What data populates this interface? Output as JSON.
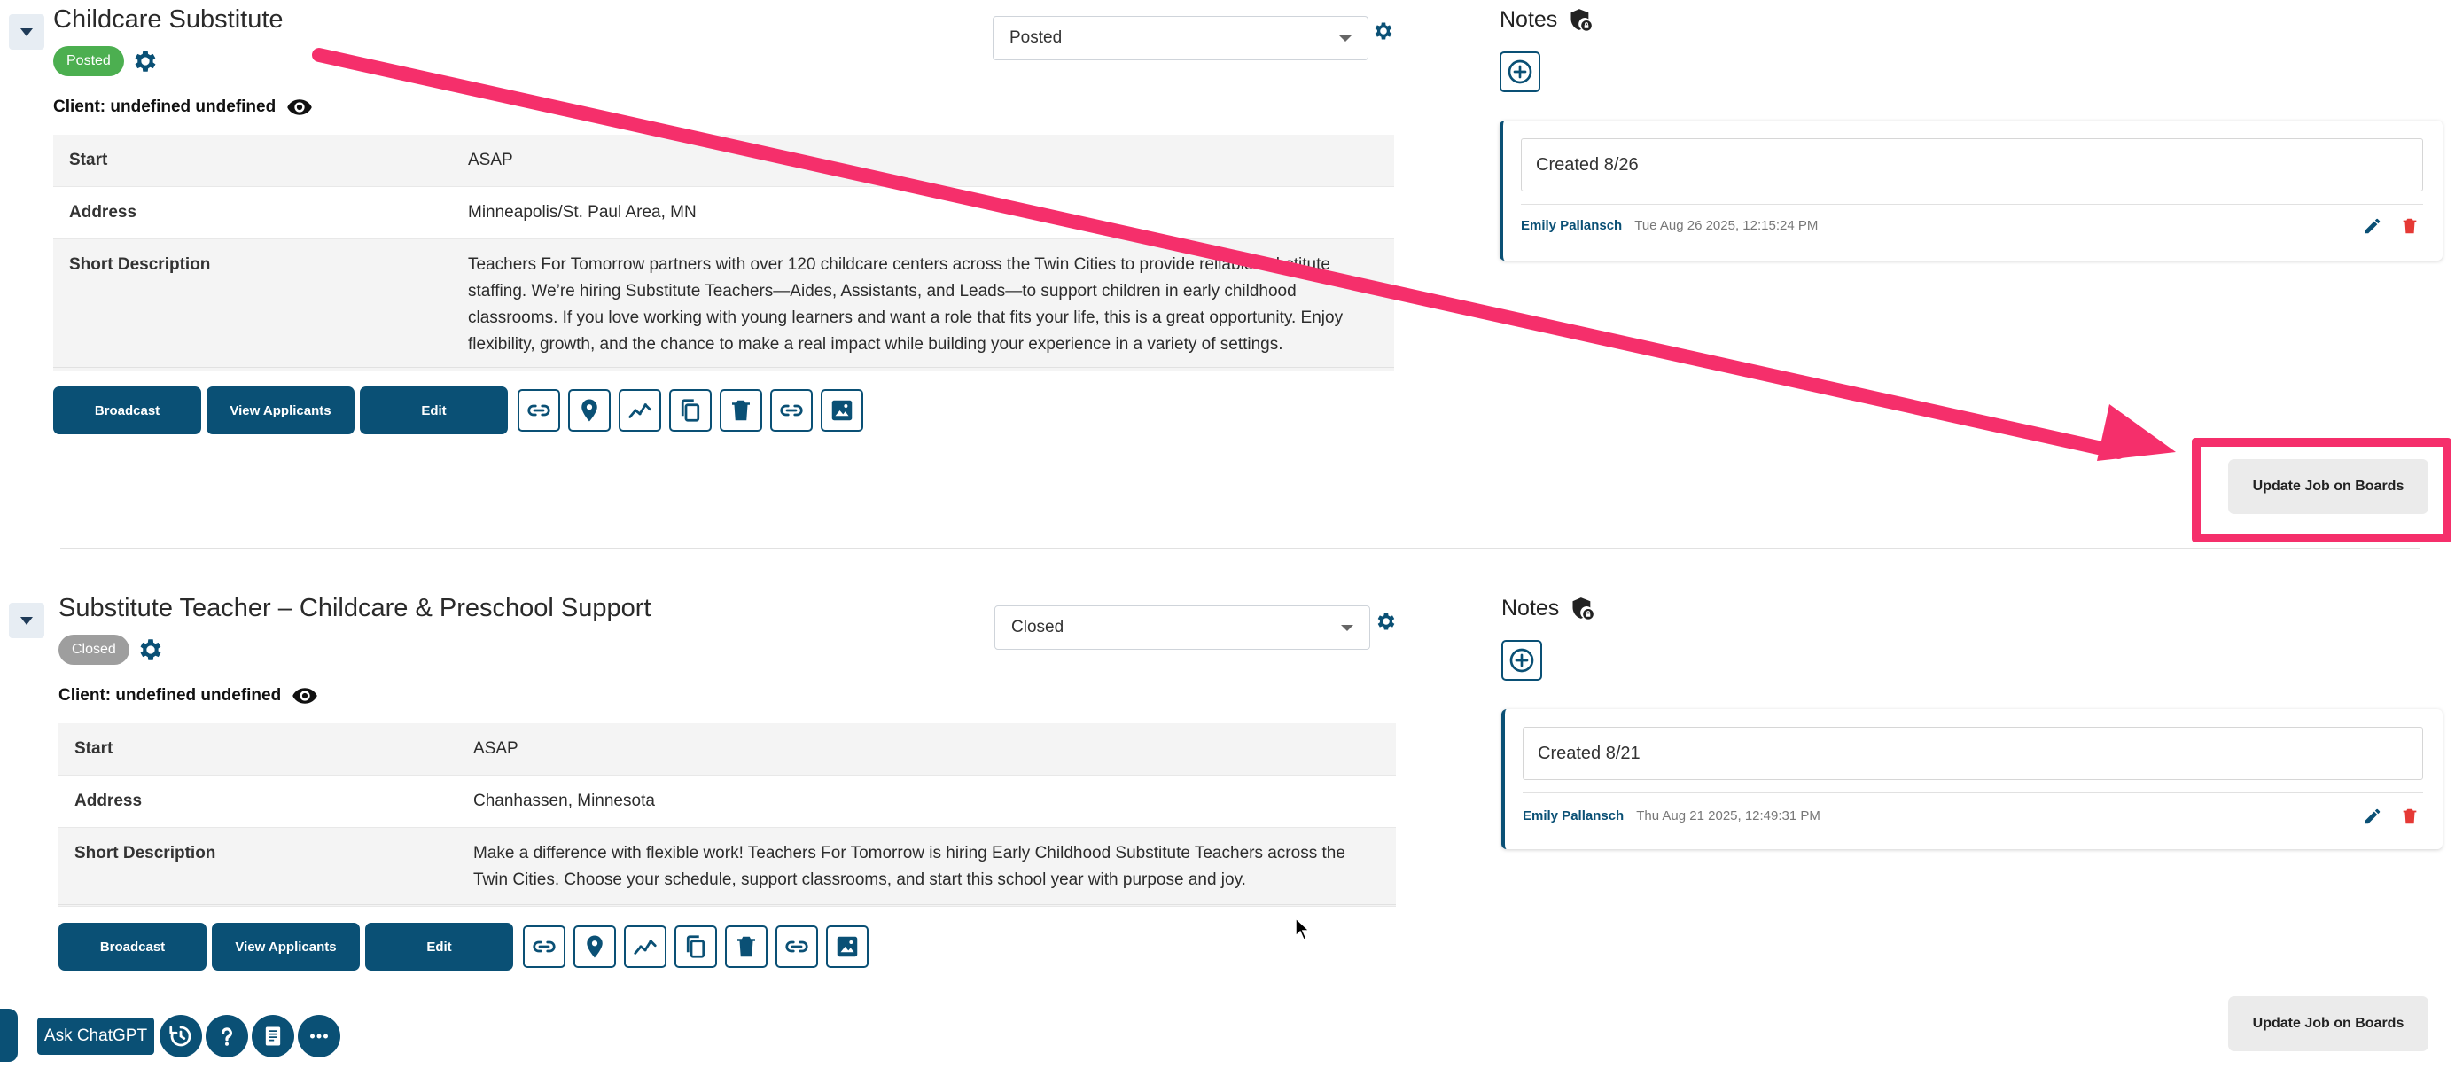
{
  "jobs": [
    {
      "title": "Childcare Substitute",
      "status_badge": "Posted",
      "status_select": "Posted",
      "client_label": "Client: undefined undefined",
      "details": [
        {
          "label": "Start",
          "value": "ASAP"
        },
        {
          "label": "Address",
          "value": "Minneapolis/St. Paul Area, MN"
        },
        {
          "label": "Short Description",
          "value": "Teachers For Tomorrow partners with over 120 childcare centers across the Twin Cities to provide reliable substitute staffing. We’re hiring Substitute Teachers—Aides, Assistants, and Leads—to support children in early childhood classrooms. If you love working with young learners and want a role that fits your life, this is a great opportunity. Enjoy flexibility, growth, and the chance to make a real impact while building your experience in a variety of settings."
        }
      ],
      "buttons": {
        "broadcast": "Broadcast",
        "view_applicants": "View Applicants",
        "edit": "Edit"
      },
      "notes": {
        "title": "Notes",
        "items": [
          {
            "text": "Created 8/26",
            "author": "Emily Pallansch",
            "date": "Tue Aug 26 2025, 12:15:24 PM"
          }
        ]
      },
      "update_button": "Update Job on Boards"
    },
    {
      "title": "Substitute Teacher – Childcare & Preschool Support",
      "status_badge": "Closed",
      "status_select": "Closed",
      "client_label": "Client: undefined undefined",
      "details": [
        {
          "label": "Start",
          "value": "ASAP"
        },
        {
          "label": "Address",
          "value": "Chanhassen, Minnesota"
        },
        {
          "label": "Short Description",
          "value": "Make a difference with flexible work! Teachers For Tomorrow is hiring Early Childhood Substitute Teachers across the Twin Cities. Choose your schedule, support classrooms, and start this school year with purpose and joy."
        }
      ],
      "buttons": {
        "broadcast": "Broadcast",
        "view_applicants": "View Applicants",
        "edit": "Edit"
      },
      "notes": {
        "title": "Notes",
        "items": [
          {
            "text": "Created 8/21",
            "author": "Emily Pallansch",
            "date": "Thu Aug 21 2025, 12:49:31 PM"
          }
        ]
      },
      "update_button": "Update Job on Boards"
    }
  ],
  "toolbar_icons": [
    "link-icon",
    "map-pin-icon",
    "analytics-icon",
    "copy-icon",
    "trash-icon",
    "share-link-icon",
    "image-icon"
  ],
  "footer": {
    "ask_chatgpt": "Ask ChatGPT"
  },
  "colors": {
    "primary": "#0a5075",
    "posted": "#4caf50",
    "closed": "#9e9e9e",
    "annotation": "#f52f6b",
    "delete": "#e53935"
  }
}
